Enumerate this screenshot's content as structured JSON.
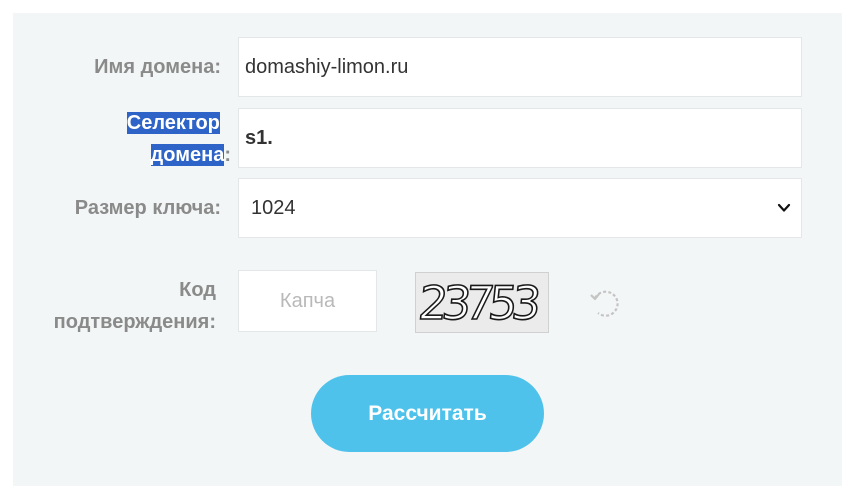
{
  "form": {
    "domain_label": "Имя домена:",
    "domain_value": "domashiy-limon.ru",
    "selector_label_line1": "Селектор",
    "selector_label_line2": "домена",
    "selector_label_colon": ":",
    "selector_value": "s1.",
    "keysize_label": "Размер ключа:",
    "keysize_value": "1024",
    "captcha_label_line1": "Код",
    "captcha_label_line2": "подтверждения:",
    "captcha_placeholder": "Капча",
    "captcha_image_text": "23753",
    "submit_label": "Рассчитать"
  },
  "icons": {
    "select_arrow": "chevron-down-icon",
    "refresh": "refresh-icon"
  },
  "colors": {
    "panel_bg": "#f3f6f6",
    "label": "#8a8a8a",
    "selection_highlight": "#2e63c7",
    "button": "#4fc2eb"
  }
}
